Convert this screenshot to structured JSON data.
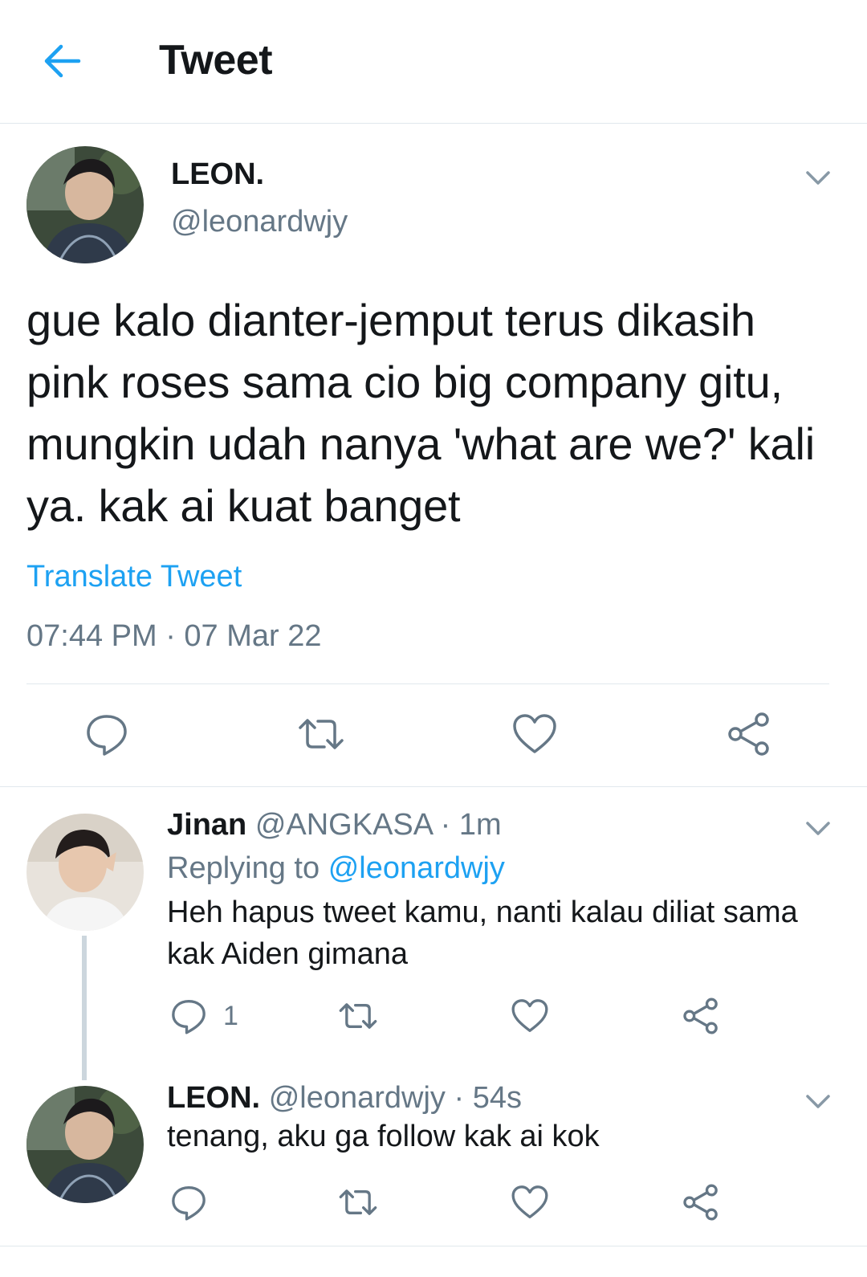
{
  "header": {
    "title": "Tweet",
    "back_icon": "arrow-left-icon"
  },
  "colors": {
    "accent": "#1da1f2",
    "text": "#14171a",
    "muted": "#657786",
    "divider": "#e1e8ed",
    "thread_line": "#ccd6dd"
  },
  "main_tweet": {
    "name": "LEON.",
    "handle": "@leonardwjy",
    "text": "gue kalo dianter-jemput terus dikasih pink roses sama cio big company gitu, mungkin udah nanya 'what are we?' kali ya. kak ai kuat banget",
    "translate_label": "Translate Tweet",
    "timestamp": "07:44 PM · 07 Mar 22",
    "actions": [
      "reply-icon",
      "retweet-icon",
      "like-icon",
      "share-icon"
    ]
  },
  "replies": [
    {
      "name": "Jinan",
      "handle": "@ANGKASA",
      "sep": "·",
      "time": "1m",
      "replying_label": "Replying to",
      "replying_handle": "@leonardwjy",
      "text": "Heh hapus tweet kamu, nanti kalau diliat sama kak Aiden gimana",
      "reply_count": "1"
    },
    {
      "name": "LEON.",
      "handle": "@leonardwjy",
      "sep": "·",
      "time": "54s",
      "text": "tenang, aku ga follow kak ai kok"
    }
  ]
}
